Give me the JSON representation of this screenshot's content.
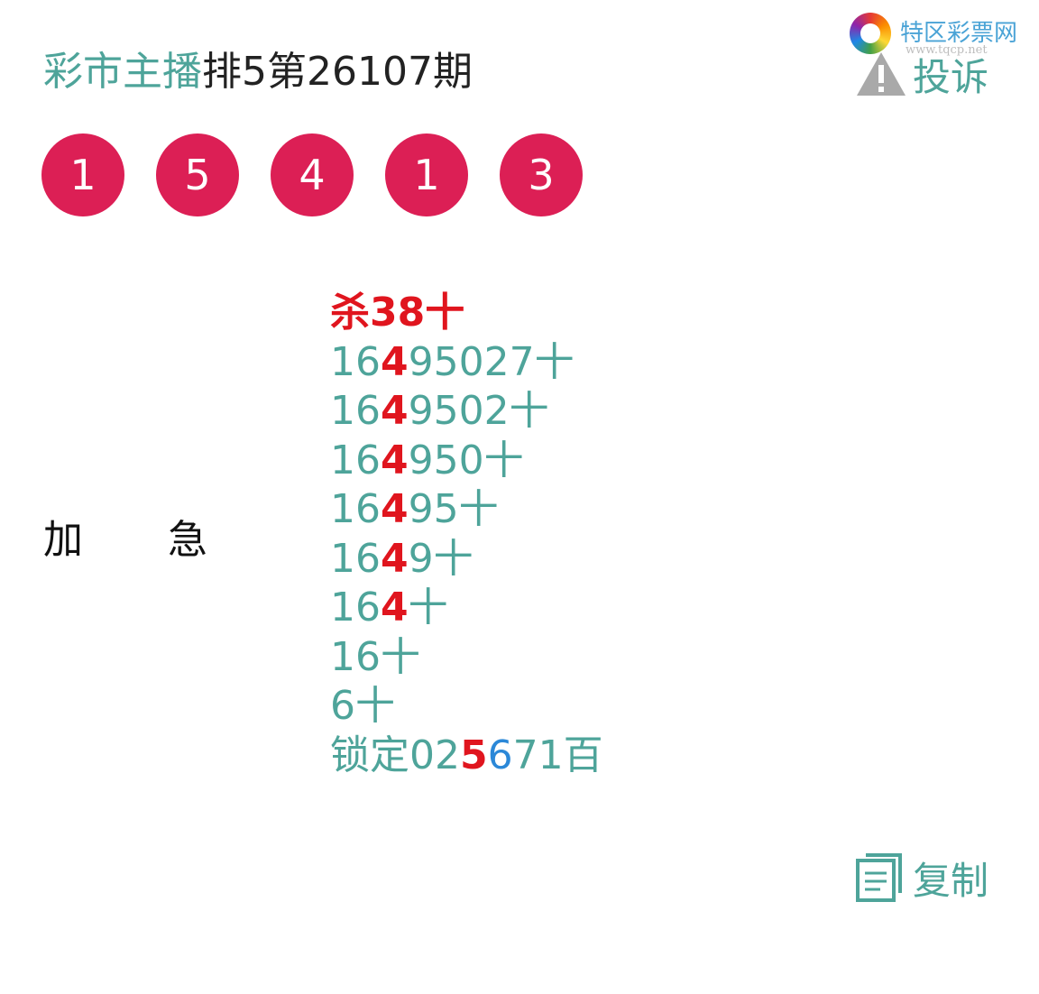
{
  "header": {
    "title_prefix": "彩市主播",
    "title_suffix": "排5第26107期"
  },
  "watermark": {
    "name": "特区彩票网",
    "url": "www.tqcp.net"
  },
  "complain": {
    "label": "投诉",
    "icon": "warning-triangle-icon"
  },
  "balls": [
    "1",
    "5",
    "4",
    "1",
    "3"
  ],
  "side_labels": [
    "加",
    "急"
  ],
  "lines": [
    {
      "kind": "kill",
      "text": "杀38十"
    },
    {
      "kind": "num",
      "a": "16",
      "hl": "4",
      "b": "95027十"
    },
    {
      "kind": "num",
      "a": "16",
      "hl": "4",
      "b": "9502十"
    },
    {
      "kind": "num",
      "a": "16",
      "hl": "4",
      "b": "950十"
    },
    {
      "kind": "num",
      "a": "16",
      "hl": "4",
      "b": "95十"
    },
    {
      "kind": "num",
      "a": "16",
      "hl": "4",
      "b": "9十"
    },
    {
      "kind": "num",
      "a": "16",
      "hl": "4",
      "b": "十"
    },
    {
      "kind": "plain",
      "text": "16十"
    },
    {
      "kind": "plain",
      "text": "6十"
    },
    {
      "kind": "lock",
      "a": "锁定02",
      "hl": "5",
      "c": "6",
      "b": "71百"
    }
  ],
  "copy": {
    "label": "复制",
    "icon": "document-copy-icon"
  },
  "colors": {
    "teal": "#4ea49a",
    "ball": "#dc1f55",
    "highlight_red": "#e0151e",
    "highlight_blue": "#2b88d8"
  }
}
